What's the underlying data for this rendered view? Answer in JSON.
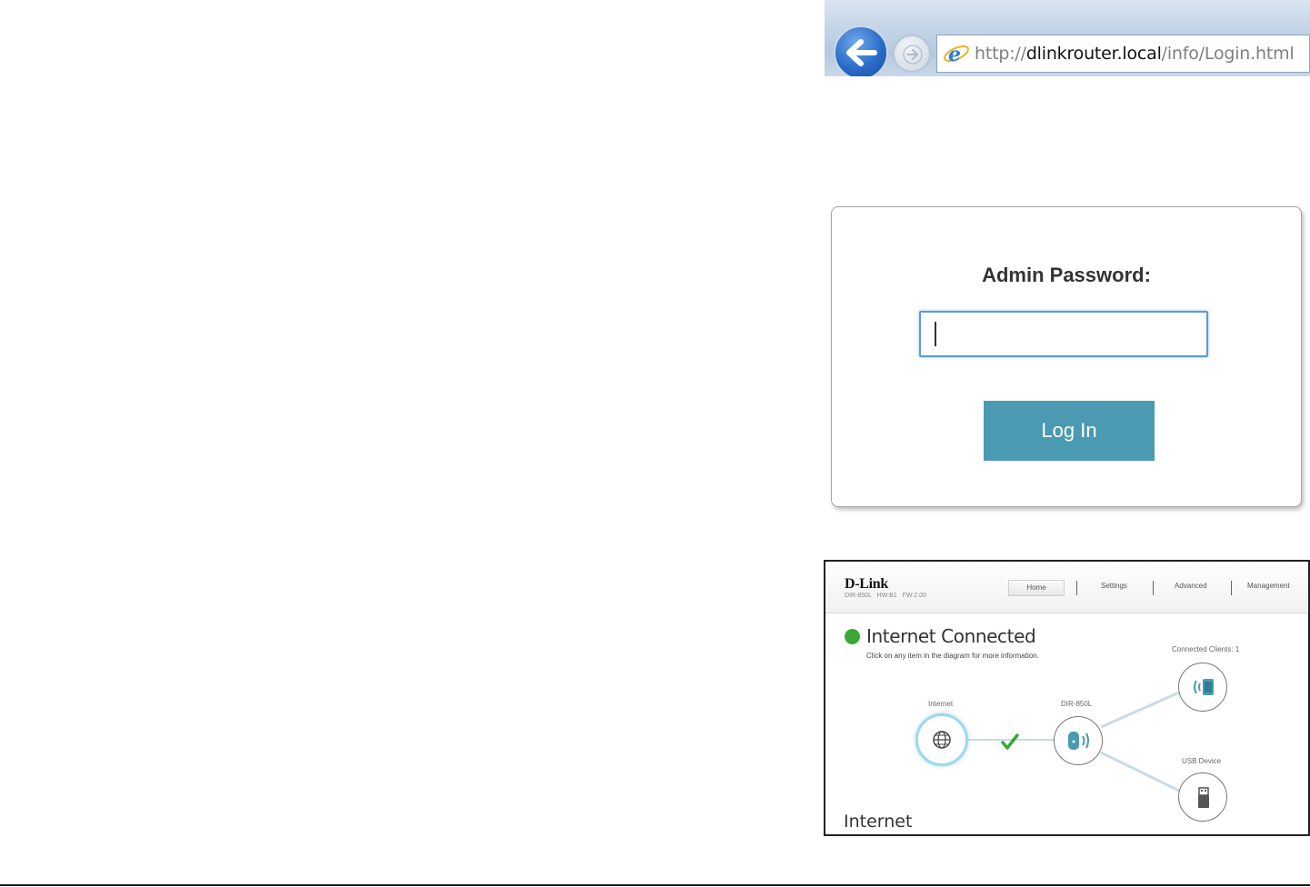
{
  "browser": {
    "address_prefix": "http://",
    "address_host": "dlinkrouter.local",
    "address_path": "/info/Login.html"
  },
  "login": {
    "label": "Admin Password:",
    "password_value": "",
    "button_label": "Log In",
    "accent_color": "#4a9ab1"
  },
  "router_home": {
    "logo": "D-Link",
    "model_info": "DIR-850L HW:B1 FW:2.00",
    "nav": [
      "Home",
      "Settings",
      "Advanced",
      "Management"
    ],
    "status_title": "Internet Connected",
    "status_hint": "Click on any item in the diagram for more information.",
    "status_color": "#39a935",
    "nodes": {
      "internet": "Internet",
      "router": "DIR-850L",
      "clients": "Connected Clients: 1",
      "usb": "USB Device"
    },
    "section_title": "Internet"
  }
}
